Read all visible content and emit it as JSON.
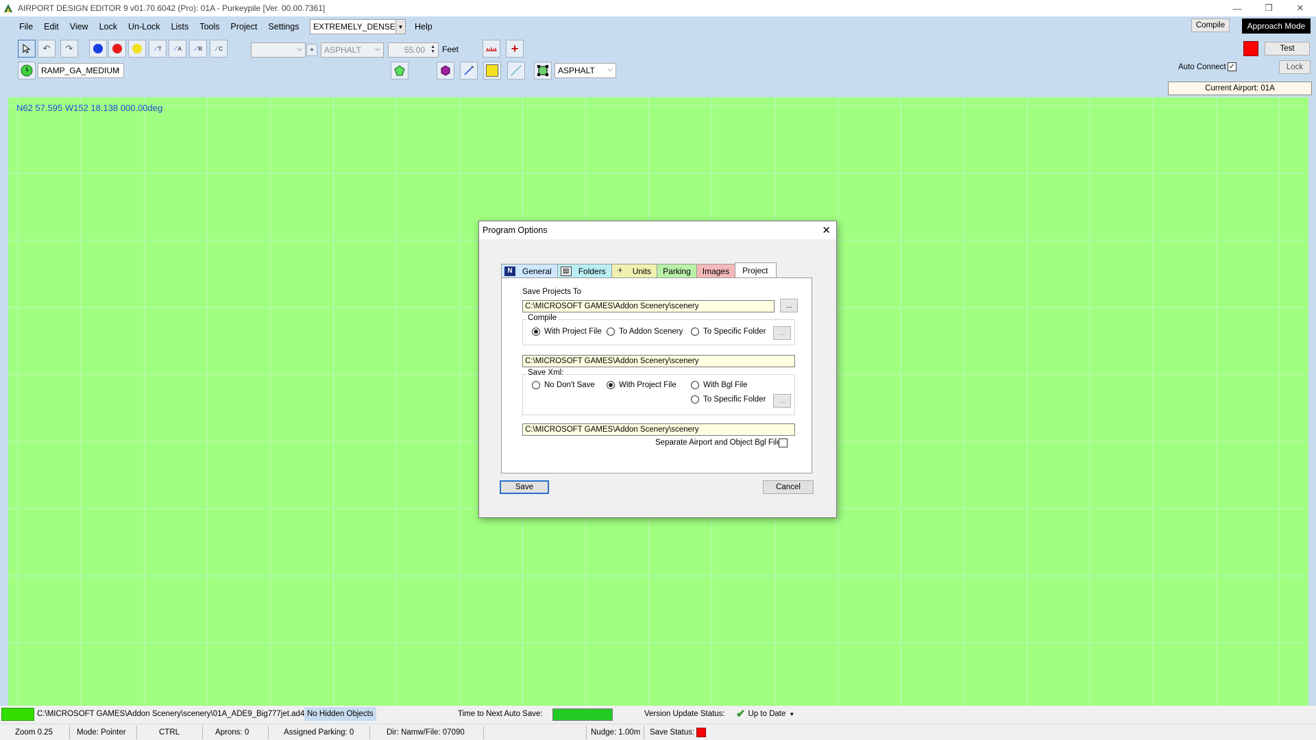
{
  "window": {
    "title": "AIRPORT DESIGN EDITOR 9  v01.70.6042  (Pro): 01A - Purkeypile [Ver. 00.00.7361]",
    "minimize": "—",
    "restore": "❐",
    "close": "✕"
  },
  "menu": {
    "items": [
      "File",
      "Edit",
      "View",
      "Lock",
      "Un-Lock",
      "Lists",
      "Tools",
      "Project",
      "Settings"
    ],
    "density": "EXTREMELY_DENSE",
    "help": "Help"
  },
  "toolbar": {
    "ramp_type": "RAMP_GA_MEDIUM",
    "surface_1": "ASPHALT",
    "width_value": "55.00",
    "width_unit": "Feet",
    "surface_2": "ASPHALT",
    "plus_label": "+",
    "t_label": "T",
    "a_label": "A",
    "r_label": "R",
    "c_label": "C"
  },
  "right_panel": {
    "compile": "Compile",
    "approach_mode": "Approach Mode",
    "test": "Test",
    "auto_connect": "Auto Connect",
    "lock": "Lock",
    "current_airport": "Current Airport: 01A",
    "status_color": "#ff0000"
  },
  "map": {
    "coords": "N62 57.595   W152 18.138 000.00deg",
    "bg_color": "#a0ff80"
  },
  "dialog": {
    "title": "Program Options",
    "tabs": [
      {
        "label": "General",
        "color": "#cfe8ff",
        "icon": "general-icon"
      },
      {
        "label": "Folders",
        "color": "#b9eef2",
        "icon": "folders-icon"
      },
      {
        "label": "Units",
        "color": "#f0f0b0",
        "icon": "units-icon"
      },
      {
        "label": "Parking",
        "color": "#b8f0a8",
        "icon": ""
      },
      {
        "label": "Images",
        "color": "#f4b8b8",
        "icon": ""
      },
      {
        "label": "Project",
        "color": "#ffffff",
        "icon": ""
      }
    ],
    "save_projects_to_label": "Save Projects To",
    "save_projects_to_path": "C:\\MICROSOFT GAMES\\Addon Scenery\\scenery",
    "browse": "...",
    "compile_group": "Compile",
    "compile_options": [
      "With Project File",
      "To Addon Scenery",
      "To Specific Folder"
    ],
    "compile_selected": 0,
    "compile_path": "C:\\MICROSOFT GAMES\\Addon Scenery\\scenery",
    "save_xml_group": "Save Xml:",
    "save_xml_options": [
      "No Don't Save",
      "With Project File",
      "With Bgl File",
      "To Specific Folder"
    ],
    "save_xml_selected": 1,
    "xml_path": "C:\\MICROSOFT GAMES\\Addon Scenery\\scenery",
    "separate_bgl_label": "Separate Airport and Object Bgl Files",
    "save_button": "Save",
    "cancel_button": "Cancel"
  },
  "statusbar": {
    "file_path": "C:\\MICROSOFT GAMES\\Addon Scenery\\scenery\\01A_ADE9_Big777jet.ad4",
    "hidden_objects": "No Hidden Objects",
    "auto_save_label": "Time to Next Auto Save:",
    "version_status_label": "Version Update Status:",
    "version_status": "Up to Date",
    "zoom": "Zoom 0.25",
    "mode": "Mode: Pointer",
    "ctrl": "CTRL",
    "aprons": "Aprons: 0",
    "assigned_parking": "Assigned Parking: 0",
    "dir": "Dir: Namw/File: 07090",
    "nudge": "Nudge: 1.00m",
    "save_status_label": "Save Status:",
    "save_status_color": "#ff0000",
    "autosave_color": "#22cc22"
  }
}
